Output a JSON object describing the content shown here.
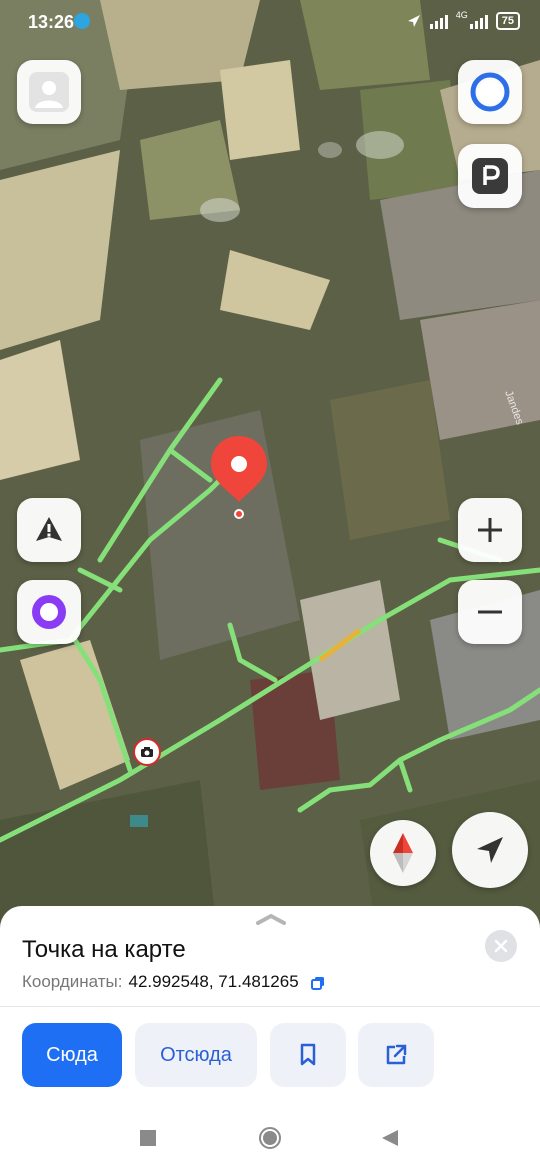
{
  "status_bar": {
    "time": "13:26",
    "network": "4G",
    "battery": "75"
  },
  "map": {
    "label": "Jandes"
  },
  "sheet": {
    "title": "Точка на карте",
    "coords_label": "Координаты:",
    "coords_value": "42.992548, 71.481265",
    "buttons": {
      "to": "Сюда",
      "from": "Отсюда"
    }
  },
  "colors": {
    "accent": "#1f6ff5",
    "pin": "#f0453a",
    "road": "#86e07a",
    "alice": "#8a3cf5"
  },
  "icons": [
    "avatar-icon",
    "alice-assistant-icon",
    "parking-icon",
    "alert-icon",
    "zoom-in-icon",
    "zoom-out-icon",
    "compass-icon",
    "locate-icon",
    "camera-icon",
    "close-icon",
    "copy-icon",
    "bookmark-icon",
    "share-icon"
  ]
}
